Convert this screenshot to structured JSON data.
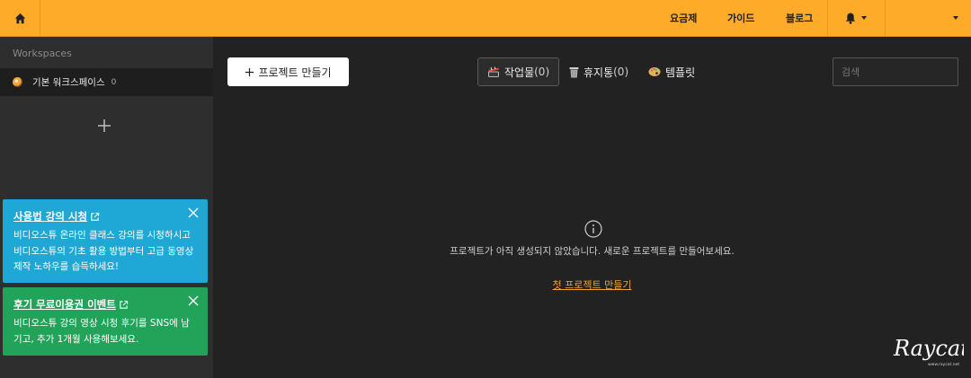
{
  "topbar": {
    "nav": [
      "요금제",
      "가이드",
      "블로그"
    ],
    "icons": [
      "home-icon",
      "bell-icon",
      "chevron-down-icon"
    ]
  },
  "sidebar": {
    "title": "Workspaces",
    "workspace": {
      "name": "기본 워크스페이스",
      "count": "0"
    },
    "cards": [
      {
        "title": "사용법 강의 시청",
        "body": "비디오스튜 온라인 클래스 강의를 시청하시고 비디오스튜의 기초 활용 방법부터 고급 동영상 제작 노하우를 습득하세요!",
        "color": "#1fa8d6"
      },
      {
        "title": "후기 무료이용권 이벤트",
        "body": "비디오스튜 강의 영상 시청 후기를 SNS에 남기고, 추가 1개월 사용해보세요.",
        "color": "#22a35a"
      }
    ]
  },
  "main": {
    "new_project": "프로젝트 만들기",
    "tabs": [
      {
        "label": "작업물",
        "count": "(0)"
      },
      {
        "label": "휴지통",
        "count": "(0)"
      },
      {
        "label": "템플릿",
        "count": ""
      }
    ],
    "search_placeholder": "검색",
    "empty_text": "프로젝트가 아직 생성되지 않았습니다. 새로운 프로젝트를 만들어보세요.",
    "empty_link": "첫 프로젝트 만들기"
  },
  "watermark": {
    "brand": "Raycat",
    "url": "www.raycat.net"
  },
  "colors": {
    "accent": "#fdab29",
    "link": "#f0a233",
    "card_blue": "#1fa8d6",
    "card_green": "#22a35a"
  }
}
